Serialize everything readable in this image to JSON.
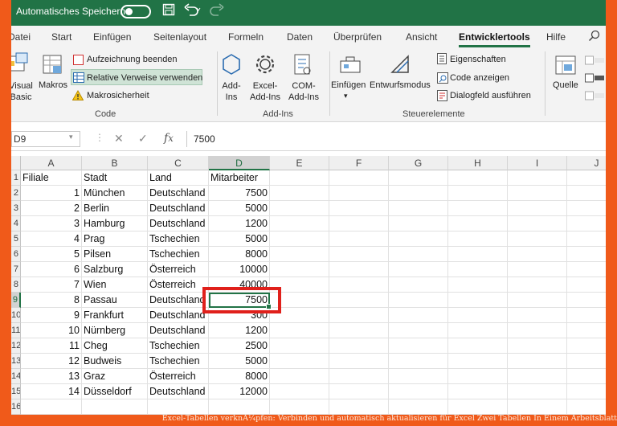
{
  "titlebar": {
    "autosave_label": "Automatisches Speichern"
  },
  "tabs": [
    {
      "label": "Datei"
    },
    {
      "label": "Start"
    },
    {
      "label": "Einfügen"
    },
    {
      "label": "Seitenlayout"
    },
    {
      "label": "Formeln"
    },
    {
      "label": "Daten"
    },
    {
      "label": "Überprüfen"
    },
    {
      "label": "Ansicht"
    },
    {
      "label": "Entwicklertools"
    },
    {
      "label": "Hilfe"
    }
  ],
  "ribbon": {
    "code": {
      "visual_basic_line1": "Visual",
      "visual_basic_line2": "Basic",
      "macros": "Makros",
      "record_macro": "Aufzeichnung beenden",
      "relative_refs": "Relative Verweise verwenden",
      "macro_security": "Makrosicherheit",
      "group_label": "Code"
    },
    "addins": {
      "addins_line1": "Add-",
      "addins_line2": "Ins",
      "excel_addins_line1": "Excel-",
      "excel_addins_line2": "Add-Ins",
      "com_addins_line1": "COM-",
      "com_addins_line2": "Add-Ins",
      "group_label": "Add-Ins"
    },
    "controls": {
      "insert": "Einfügen",
      "design_mode": "Entwurfsmodus",
      "properties": "Eigenschaften",
      "view_code": "Code anzeigen",
      "run_dialog": "Dialogfeld ausführen",
      "group_label": "Steuerelemente"
    },
    "xml": {
      "source": "Quelle"
    }
  },
  "formula_bar": {
    "name_box": "D9",
    "formula": "7500"
  },
  "grid": {
    "columns": [
      "A",
      "B",
      "C",
      "D",
      "E",
      "F",
      "G",
      "H",
      "I",
      "J"
    ],
    "row_numbers": [
      "1",
      "2",
      "3",
      "4",
      "5",
      "6",
      "7",
      "8",
      "9",
      "10",
      "11",
      "12",
      "13",
      "14",
      "15",
      "16"
    ],
    "header": [
      "Filiale",
      "Stadt",
      "Land",
      "Mitarbeiter"
    ],
    "rows": [
      [
        "1",
        "München",
        "Deutschland",
        "7500"
      ],
      [
        "2",
        "Berlin",
        "Deutschland",
        "5000"
      ],
      [
        "3",
        "Hamburg",
        "Deutschland",
        "1200"
      ],
      [
        "4",
        "Prag",
        "Tschechien",
        "5000"
      ],
      [
        "5",
        "Pilsen",
        "Tschechien",
        "8000"
      ],
      [
        "6",
        "Salzburg",
        "Österreich",
        "10000"
      ],
      [
        "7",
        "Wien",
        "Österreich",
        "40000"
      ],
      [
        "8",
        "Passau",
        "Deutschland",
        "7500"
      ],
      [
        "9",
        "Frankfurt",
        "Deutschland",
        "300"
      ],
      [
        "10",
        "Nürnberg",
        "Deutschland",
        "1200"
      ],
      [
        "11",
        "Cheg",
        "Tschechien",
        "2500"
      ],
      [
        "12",
        "Budweis",
        "Tschechien",
        "5000"
      ],
      [
        "13",
        "Graz",
        "Österreich",
        "8000"
      ],
      [
        "14",
        "Düsseldorf",
        "Deutschland",
        "12000"
      ]
    ]
  },
  "caption": "Excel-Tabellen verknÃ¼pfen: Verbinden und automatisch aktualisieren für Excel Zwei Tabellen In Einem Arbeitsblatt",
  "colors": {
    "excel_green": "#217346",
    "highlight_red": "#e0201b",
    "frame_orange": "#f05a1a"
  }
}
